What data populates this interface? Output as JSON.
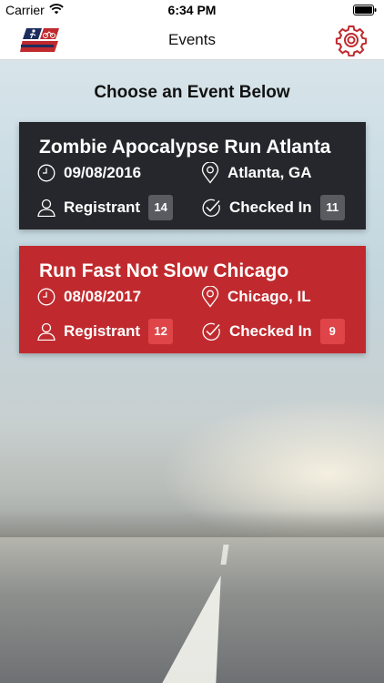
{
  "status_bar": {
    "carrier": "Carrier",
    "time": "6:34 PM"
  },
  "nav": {
    "title": "Events"
  },
  "heading": "Choose an Event Below",
  "events": [
    {
      "name": "Zombie Apocalypse Run Atlanta",
      "date": "09/08/2016",
      "location": "Atlanta, GA",
      "registrant_label": "Registrant",
      "registrant_count": "14",
      "checked_in_label": "Checked In",
      "checked_in_count": "11",
      "color": "#26272c"
    },
    {
      "name": "Run Fast Not Slow Chicago",
      "date": "08/08/2017",
      "location": "Chicago, IL",
      "registrant_label": "Registrant",
      "registrant_count": "12",
      "checked_in_label": "Checked In",
      "checked_in_count": "9",
      "color": "#c02a2e"
    }
  ],
  "colors": {
    "accent": "#c02a2e",
    "card_dark": "#26272c"
  },
  "icons": [
    "wifi-icon",
    "battery-icon",
    "logo-icon",
    "gear-icon",
    "clock-icon",
    "location-pin-icon",
    "person-icon",
    "check-circle-icon"
  ]
}
